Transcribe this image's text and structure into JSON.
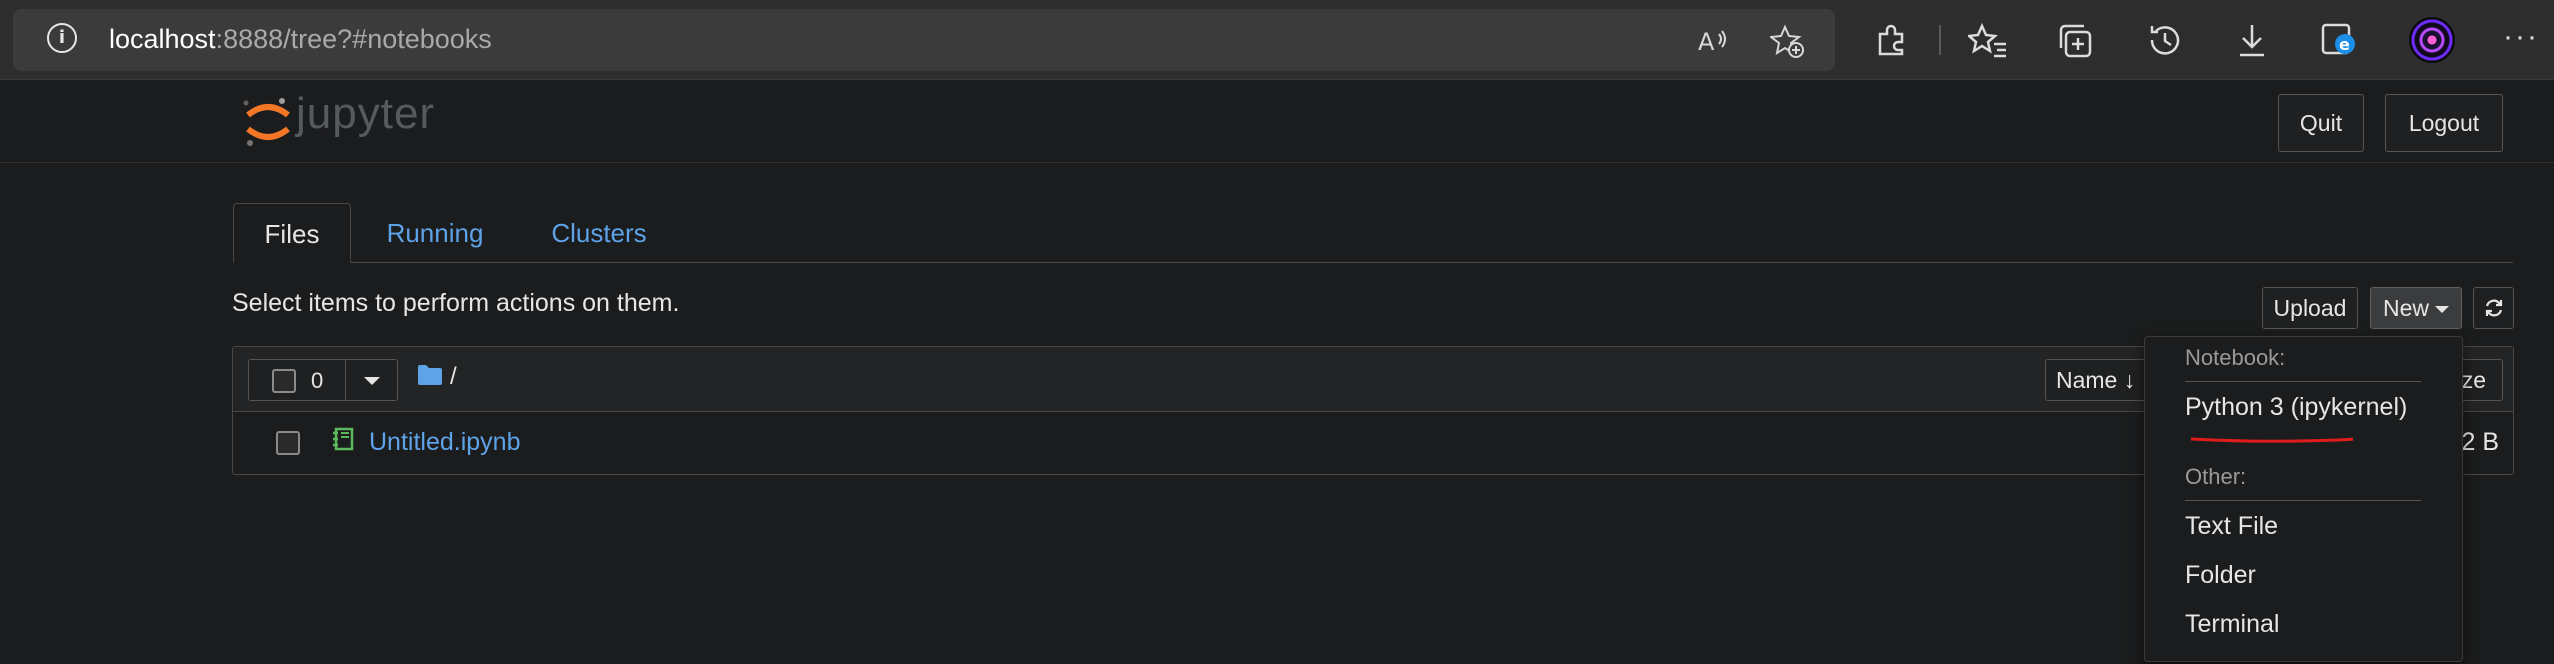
{
  "browser": {
    "url_host": "localhost",
    "url_rest": ":8888/tree?#notebooks",
    "icons": [
      "info-icon",
      "read-aloud-icon",
      "add-favorite-icon",
      "extensions-icon",
      "favorites-icon",
      "collections-icon",
      "history-icon",
      "downloads-icon",
      "edge-e-icon",
      "profile-avatar",
      "more-options-icon"
    ]
  },
  "header": {
    "logo_text": "jupyter",
    "quit_label": "Quit",
    "logout_label": "Logout"
  },
  "tabs": [
    {
      "label": "Files",
      "active": true
    },
    {
      "label": "Running",
      "active": false
    },
    {
      "label": "Clusters",
      "active": false
    }
  ],
  "toolbar": {
    "instructions": "Select items to perform actions on them.",
    "upload_label": "Upload",
    "new_label": "New",
    "refresh_icon": "refresh-icon"
  },
  "list": {
    "selected_count": "0",
    "breadcrumb": "/",
    "name_header": "Name",
    "size_header": "ze",
    "files": [
      {
        "name": "Untitled.ipynb",
        "size": "2 B"
      }
    ]
  },
  "new_menu": {
    "notebook_header": "Notebook:",
    "kernel_item": "Python 3 (ipykernel)",
    "other_header": "Other:",
    "items": [
      "Text File",
      "Folder",
      "Terminal"
    ]
  },
  "colors": {
    "background": "#1b1c1d",
    "link": "#5ea2e8",
    "jupyter_orange": "#f37726",
    "notebook_green": "#5cb85c",
    "annotation_red": "#e01b1b"
  }
}
